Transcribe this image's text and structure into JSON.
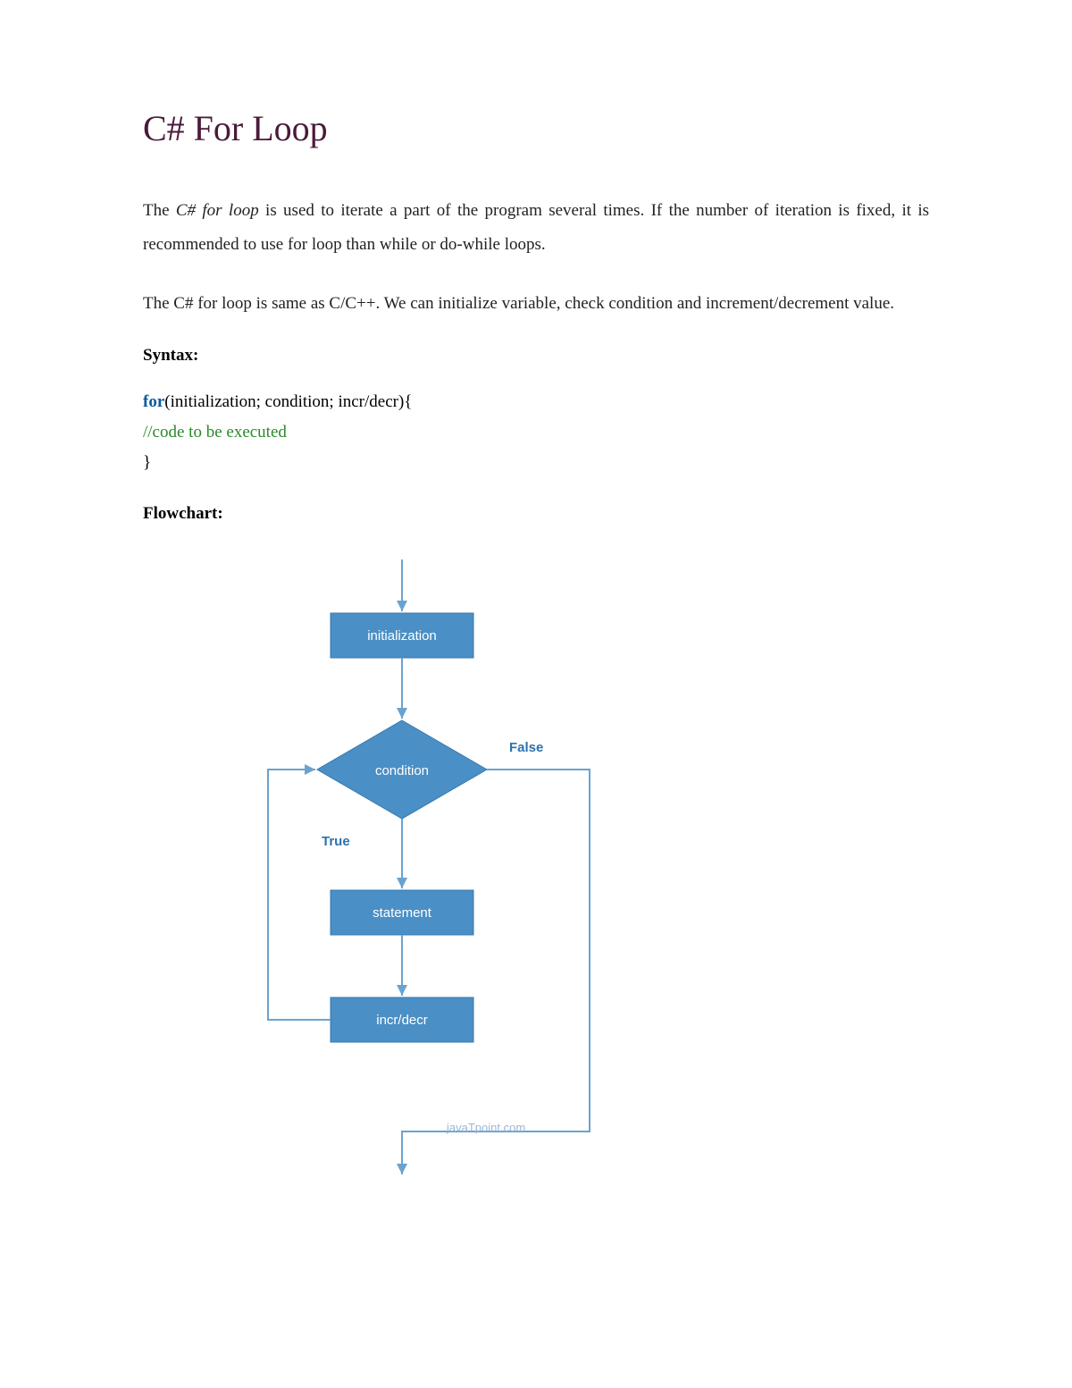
{
  "title": "C# For Loop",
  "para1_a": "The ",
  "para1_b": "C# for loop",
  "para1_c": " is used to iterate a part of the program several times. If the number of iteration is fixed, it is recommended to use for loop than while or do-while loops.",
  "para2": "The C# for loop is same as C/C++. We can initialize variable, check condition and increment/decrement value.",
  "syntax_label": "Syntax:",
  "code": {
    "kw": "for",
    "sig": "(initialization; condition; incr/decr){",
    "comment": "//code to be executed",
    "close": "}"
  },
  "flow_label": "Flowchart:",
  "chart_data": {
    "type": "flowchart",
    "nodes": [
      {
        "id": "init",
        "shape": "rect",
        "label": "initialization"
      },
      {
        "id": "cond",
        "shape": "diamond",
        "label": "condition"
      },
      {
        "id": "stmt",
        "shape": "rect",
        "label": "statement"
      },
      {
        "id": "incr",
        "shape": "rect",
        "label": "incr/decr"
      }
    ],
    "edges": [
      {
        "from": "start",
        "to": "init"
      },
      {
        "from": "init",
        "to": "cond"
      },
      {
        "from": "cond",
        "to": "stmt",
        "label": "True"
      },
      {
        "from": "cond",
        "to": "exit",
        "label": "False"
      },
      {
        "from": "stmt",
        "to": "incr"
      },
      {
        "from": "incr",
        "to": "cond"
      }
    ],
    "credit": "javaTpoint.com"
  }
}
